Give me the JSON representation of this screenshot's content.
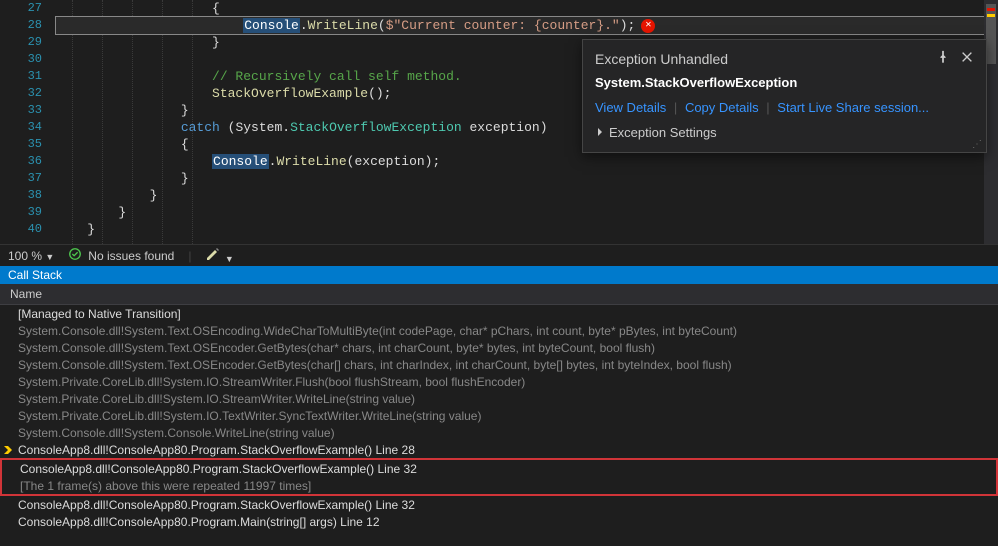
{
  "editor": {
    "lines": [
      {
        "n": 27,
        "indent": 5,
        "raw": "{"
      },
      {
        "n": 28,
        "indent": 6,
        "highlighted": true,
        "segments": [
          {
            "t": "Console",
            "cls": "tok-sel"
          },
          {
            "t": ".",
            "cls": "tok-plain"
          },
          {
            "t": "WriteLine",
            "cls": "tok-method"
          },
          {
            "t": "(",
            "cls": "tok-plain"
          },
          {
            "t": "$\"Current counter: {counter}.\"",
            "cls": "tok-string"
          },
          {
            "t": ");",
            "cls": "tok-plain"
          }
        ],
        "err": true
      },
      {
        "n": 29,
        "indent": 5,
        "raw": "}"
      },
      {
        "n": 30,
        "indent": 0,
        "raw": ""
      },
      {
        "n": 31,
        "indent": 5,
        "segments": [
          {
            "t": "// Recursively call self method.",
            "cls": "tok-comment"
          }
        ]
      },
      {
        "n": 32,
        "indent": 5,
        "segments": [
          {
            "t": "StackOverflowExample",
            "cls": "tok-method"
          },
          {
            "t": "();",
            "cls": "tok-plain"
          }
        ]
      },
      {
        "n": 33,
        "indent": 4,
        "raw": "}"
      },
      {
        "n": 34,
        "indent": 4,
        "segments": [
          {
            "t": "catch",
            "cls": "tok-keyword"
          },
          {
            "t": " (System.",
            "cls": "tok-plain"
          },
          {
            "t": "StackOverflowException",
            "cls": "tok-type"
          },
          {
            "t": " exception)",
            "cls": "tok-plain"
          }
        ]
      },
      {
        "n": 35,
        "indent": 4,
        "raw": "{"
      },
      {
        "n": 36,
        "indent": 5,
        "segments": [
          {
            "t": "Console",
            "cls": "tok-sel"
          },
          {
            "t": ".",
            "cls": "tok-plain"
          },
          {
            "t": "WriteLine",
            "cls": "tok-method"
          },
          {
            "t": "(exception);",
            "cls": "tok-plain"
          }
        ]
      },
      {
        "n": 37,
        "indent": 4,
        "raw": "}"
      },
      {
        "n": 38,
        "indent": 3,
        "raw": "}"
      },
      {
        "n": 39,
        "indent": 2,
        "raw": "}"
      },
      {
        "n": 40,
        "indent": 1,
        "raw": "}"
      }
    ]
  },
  "popup": {
    "title": "Exception Unhandled",
    "exceptionType": "System.StackOverflowException",
    "links": {
      "viewDetails": "View Details",
      "copyDetails": "Copy Details",
      "liveShare": "Start Live Share session..."
    },
    "settingsLabel": "Exception Settings"
  },
  "statusbar": {
    "zoom": "100 %",
    "issues": "No issues found"
  },
  "callStack": {
    "tabLabel": "Call Stack",
    "columnHeader": "Name",
    "rows": [
      {
        "text": "[Managed to Native Transition]",
        "bright": true
      },
      {
        "text": "System.Console.dll!System.Text.OSEncoding.WideCharToMultiByte(int codePage, char* pChars, int count, byte* pBytes, int byteCount)"
      },
      {
        "text": "System.Console.dll!System.Text.OSEncoder.GetBytes(char* chars, int charCount, byte* bytes, int byteCount, bool flush)"
      },
      {
        "text": "System.Console.dll!System.Text.OSEncoder.GetBytes(char[] chars, int charIndex, int charCount, byte[] bytes, int byteIndex, bool flush)"
      },
      {
        "text": "System.Private.CoreLib.dll!System.IO.StreamWriter.Flush(bool flushStream, bool flushEncoder)"
      },
      {
        "text": "System.Private.CoreLib.dll!System.IO.StreamWriter.WriteLine(string value)"
      },
      {
        "text": "System.Private.CoreLib.dll!System.IO.TextWriter.SyncTextWriter.WriteLine(string value)"
      },
      {
        "text": "System.Console.dll!System.Console.WriteLine(string value)"
      },
      {
        "text": "ConsoleApp8.dll!ConsoleApp80.Program.StackOverflowExample() Line 28",
        "bright": true,
        "arrow": true
      },
      {
        "text": "ConsoleApp8.dll!ConsoleApp80.Program.StackOverflowExample() Line 32",
        "bright": true,
        "boxed": "top"
      },
      {
        "text": "[The 1 frame(s) above this were repeated 11997 times]",
        "boxed": "bottom"
      },
      {
        "text": "ConsoleApp8.dll!ConsoleApp80.Program.StackOverflowExample() Line 32",
        "bright": true
      },
      {
        "text": "ConsoleApp8.dll!ConsoleApp80.Program.Main(string[] args) Line 12",
        "bright": true
      }
    ]
  }
}
